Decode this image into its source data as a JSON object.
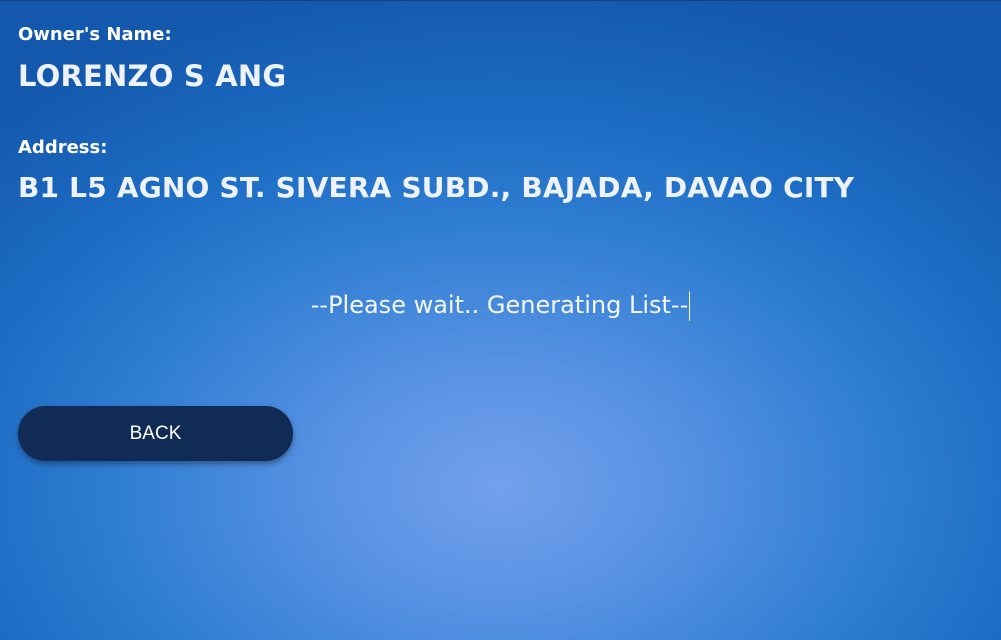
{
  "owner": {
    "label": "Owner's Name:",
    "name": "LORENZO S ANG"
  },
  "address": {
    "label": "Address:",
    "value": "B1 L5 AGNO ST. SIVERA SUBD., BAJADA, DAVAO CITY"
  },
  "status": {
    "message": "--Please wait.. Generating List--"
  },
  "actions": {
    "back_label": "BACK"
  },
  "colors": {
    "background_center": "#72a0ec",
    "background_edge": "#1358ac",
    "button_bg": "#0f2b56",
    "text": "#ffffff"
  }
}
